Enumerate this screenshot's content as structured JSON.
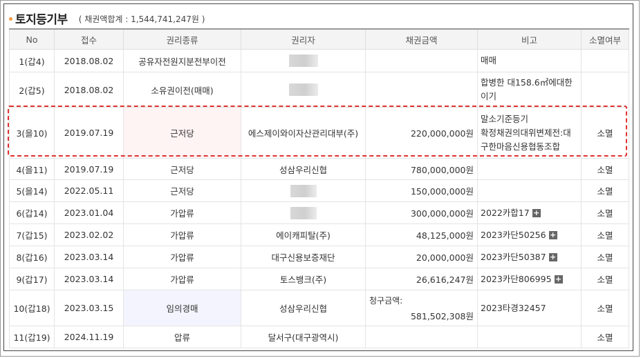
{
  "header": {
    "title": "토지등기부",
    "sum": "( 채권액합계 : 1,544,741,247원 )"
  },
  "columns": [
    "No",
    "접수",
    "권리종류",
    "권리자",
    "채권금액",
    "비고",
    "소멸여부"
  ],
  "rows": [
    {
      "no": "1(갑4)",
      "date": "2018.08.02",
      "type": "공유자전원지분전부이전",
      "holder": "",
      "holder_masked": true,
      "amount": "",
      "note": "매매",
      "extinct": ""
    },
    {
      "no": "2(갑5)",
      "date": "2018.08.02",
      "type": "소유권이전(매매)",
      "holder": "",
      "holder_masked": true,
      "amount": "",
      "note": "합병한 대158.6㎡에대한이기",
      "extinct": ""
    },
    {
      "no": "3(을10)",
      "date": "2019.07.19",
      "type": "근저당",
      "holder": "에스제이와이자산관리대부(주)",
      "amount": "220,000,000원",
      "note": "말소기준등기\n확정채권의대위변제전:대구한마음신용협동조합",
      "extinct": "소멸"
    },
    {
      "no": "4(을11)",
      "date": "2019.07.19",
      "type": "근저당",
      "holder": "성삼우리신협",
      "amount": "780,000,000원",
      "note": "",
      "extinct": "소멸"
    },
    {
      "no": "5(을14)",
      "date": "2022.05.11",
      "type": "근저당",
      "holder": "",
      "holder_masked": true,
      "amount": "150,000,000원",
      "note": "",
      "extinct": "소멸"
    },
    {
      "no": "6(갑14)",
      "date": "2023.01.04",
      "type": "가압류",
      "holder": "",
      "holder_masked": true,
      "amount": "300,000,000원",
      "note": "2022카합17",
      "extinct": "소멸"
    },
    {
      "no": "7(갑15)",
      "date": "2023.02.02",
      "type": "가압류",
      "holder": "에이캐피탈(주)",
      "amount": "48,125,000원",
      "note": "2023카단50256",
      "extinct": "소멸"
    },
    {
      "no": "8(갑16)",
      "date": "2023.03.14",
      "type": "가압류",
      "holder": "대구신용보증재단",
      "amount": "20,000,000원",
      "note": "2023카단50387",
      "extinct": "소멸"
    },
    {
      "no": "9(갑17)",
      "date": "2023.03.14",
      "type": "가압류",
      "holder": "토스뱅크(주)",
      "amount": "26,616,247원",
      "note": "2023카단806995",
      "extinct": "소멸"
    },
    {
      "no": "10(갑18)",
      "date": "2023.03.15",
      "type": "임의경매",
      "holder": "성삼우리신협",
      "amount_label": "청구금액:",
      "amount": "581,502,308원",
      "note": "2023타경32457",
      "extinct": "소멸"
    },
    {
      "no": "11(갑19)",
      "date": "2024.11.19",
      "type": "압류",
      "holder": "달서구(대구광역시)",
      "amount": "",
      "note": "",
      "extinct": "소멸"
    }
  ],
  "plus_icon": "+",
  "colors": {
    "accent": "#f39a3d",
    "highlight": "#e03030",
    "pink_cell": "#fff4f4",
    "lavender_cell": "#f4f4ff"
  }
}
